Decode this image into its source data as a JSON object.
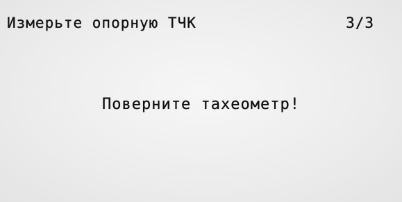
{
  "header": {
    "title": "Измерьте опорную ТЧК",
    "step": "3/3"
  },
  "message": {
    "text": "Поверните тахеометр!"
  }
}
